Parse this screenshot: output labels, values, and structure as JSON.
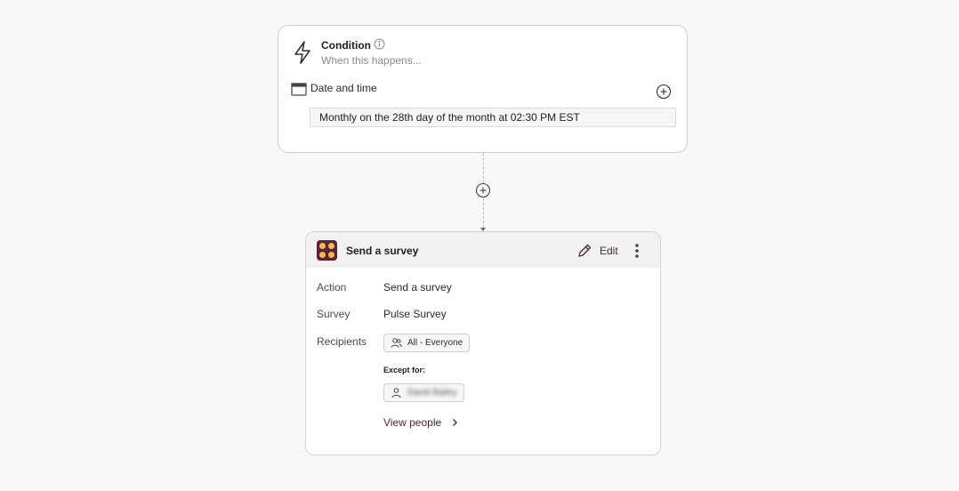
{
  "condition": {
    "title": "Condition",
    "subtitle": "When this happens...",
    "trigger_label": "Date and time",
    "schedule": "Monthly on the 28th day of the month at 02:30 PM EST",
    "icons": [
      "bolt-icon",
      "info-icon",
      "calendar-icon",
      "plus-circle-icon"
    ]
  },
  "action_card": {
    "title": "Send a survey",
    "edit_label": "Edit",
    "rows": {
      "action_label": "Action",
      "action_value": "Send a survey",
      "survey_label": "Survey",
      "survey_value": "Pulse Survey",
      "recipients_label": "Recipients",
      "recipients_chip": "All - Everyone"
    },
    "except_label": "Except for:",
    "except_person": "David Bailey",
    "view_people_label": "View people",
    "icons": [
      "app-logo",
      "pencil-icon",
      "more-vertical-icon",
      "users-icon",
      "user-icon",
      "chevron-right-icon"
    ]
  },
  "colors": {
    "accent": "#4a2633",
    "logo_bg": "#5b2337",
    "logo_dot": "#f2b94d",
    "background": "#f8f8f8"
  }
}
